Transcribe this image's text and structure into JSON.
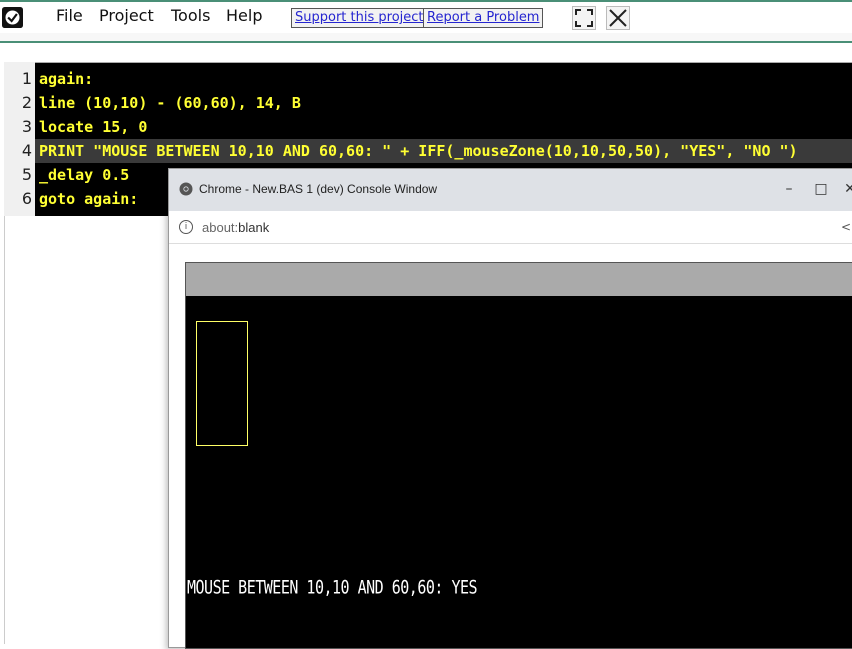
{
  "menu": {
    "file": "File",
    "project": "Project",
    "tools": "Tools",
    "help": "Help"
  },
  "links": {
    "support": "Support this project",
    "report": "Report a Problem"
  },
  "icons": {
    "logo": "check-badge-icon",
    "fullscreen": "fullscreen-icon",
    "close": "close-icon"
  },
  "editor": {
    "lines": [
      {
        "num": "1",
        "code": "again:"
      },
      {
        "num": "2",
        "code": "line (10,10) - (60,60), 14, B"
      },
      {
        "num": "3",
        "code": "locate 15, 0"
      },
      {
        "num": "4",
        "code": "PRINT \"MOUSE BETWEEN 10,10 AND 60,60: \" + IFF(_mouseZone(10,10,50,50), \"YES\", \"NO \")"
      },
      {
        "num": "5",
        "code": "_delay 0.5"
      },
      {
        "num": "6",
        "code": "goto again:"
      }
    ],
    "highlighted_line": "4"
  },
  "console_window": {
    "title": "Chrome - New.BAS 1 (dev) Console Window",
    "url_prefix": "about:",
    "url_rest": "blank",
    "output": "MOUSE BETWEEN 10,10 AND 60,60: YES",
    "minimize": "–",
    "maximize": "□",
    "close": "✕"
  },
  "colors": {
    "accent": "#4a8f77",
    "code_text": "#ffff33",
    "code_bg": "#000000",
    "highlight": "#3a3a3a"
  }
}
